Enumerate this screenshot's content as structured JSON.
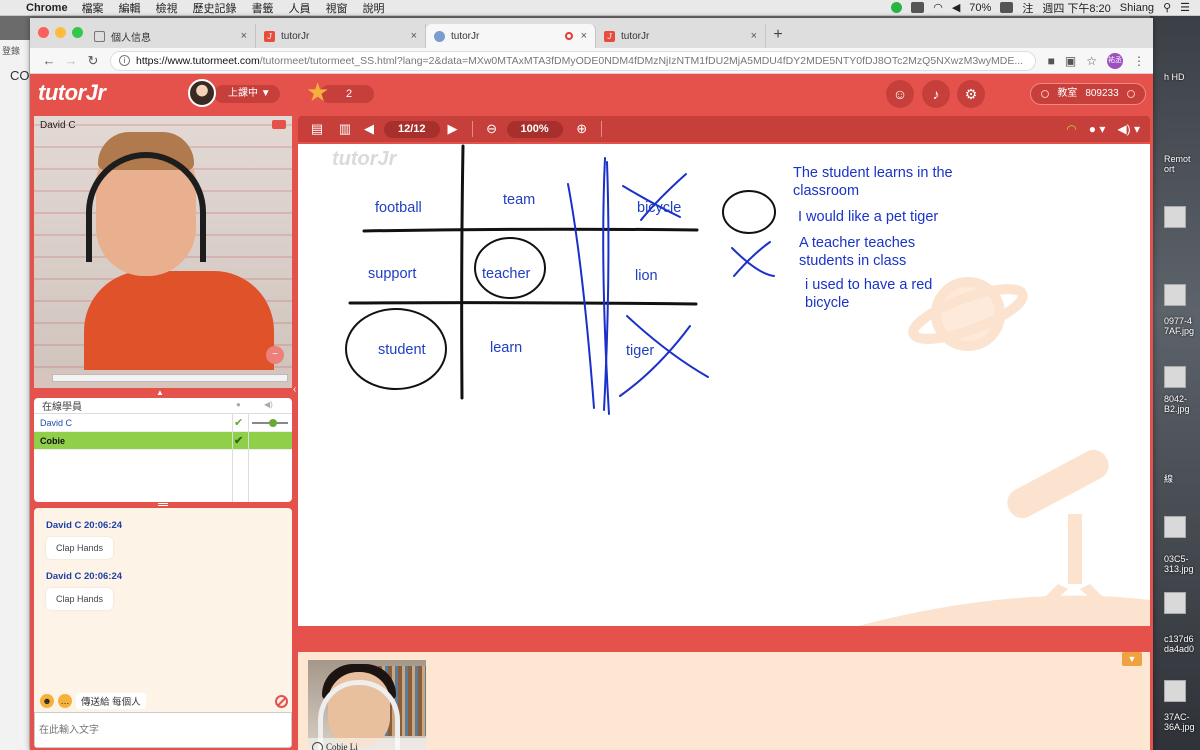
{
  "menubar": {
    "app_name": "Chrome",
    "items": [
      "檔案",
      "編輯",
      "檢視",
      "歷史記錄",
      "書籤",
      "人員",
      "視窗",
      "說明"
    ],
    "battery": "70%",
    "clock": "週四 下午8:20",
    "user": "Shiang",
    "input_method": "注"
  },
  "browser": {
    "tabs": [
      {
        "label": "個人信息",
        "icon": "doc-icon"
      },
      {
        "label": "tutorJr",
        "icon": "tutorjr-icon"
      },
      {
        "label": "tutorJr",
        "icon": "world-icon",
        "active": true,
        "recording": true
      },
      {
        "label": "tutorJr",
        "icon": "tutorjr-icon"
      }
    ],
    "close_glyph": "×",
    "new_tab_glyph": "+",
    "url_host": "https://www.tutormeet.com",
    "url_rest": "/tutormeet/tutormeet_SS.html?lang=2&data=MXw0MTAxMTA3fDMyODE0NDM4fDMzNjIzNTM1fDU2MjA5MDU4fDY2MDE5NTY0fDJ8OTc2MzQ5NXwzM3wyMDE...",
    "profile_initials": "祐丞"
  },
  "behind_window": {
    "label_top": "登錄",
    "label_side": "CO"
  },
  "desktop": {
    "labels": [
      "h HD",
      "Remot",
      "ort",
      "0977-4",
      "7AF.jpg",
      "8042-",
      "B2.jpg",
      "線",
      "03C5-",
      "313.jpg",
      "c137d6",
      "da4ad0",
      "37AC-",
      "36A.jpg"
    ]
  },
  "app": {
    "logo": "tutorJr",
    "status_label": "上課中 ▼",
    "stars": "2",
    "room_label": "教室",
    "room_number": "809233"
  },
  "teacher": {
    "name": "David C"
  },
  "students_panel": {
    "title": "在線學員",
    "rows": [
      {
        "name": "David C",
        "role": "teacher"
      },
      {
        "name": "Cobie",
        "role": "me"
      }
    ]
  },
  "chat": {
    "messages": [
      {
        "author": "David C 20:06:24",
        "text": "Clap Hands"
      },
      {
        "author": "David C 20:06:24",
        "text": "Clap Hands"
      }
    ],
    "send_to_label": "傳送給",
    "send_to_value": "每個人",
    "input_placeholder": "在此輸入文字"
  },
  "board_toolbar": {
    "page": "12/12",
    "zoom": "100%"
  },
  "board": {
    "watermark": "tutorJr",
    "grid_words": [
      "football",
      "team",
      "bicycle",
      "support",
      "teacher",
      "lion",
      "student",
      "learn",
      "tiger"
    ],
    "sentences": [
      "The student learns in the classroom",
      "I would like a pet tiger",
      "A teacher teaches students in class",
      "i used to have a red bicycle"
    ]
  },
  "student": {
    "name": "Cobie Li"
  },
  "colors": {
    "brand_red": "#e5524c",
    "ink_blue": "#1f3fc1",
    "active_green": "#8fcf4a"
  }
}
